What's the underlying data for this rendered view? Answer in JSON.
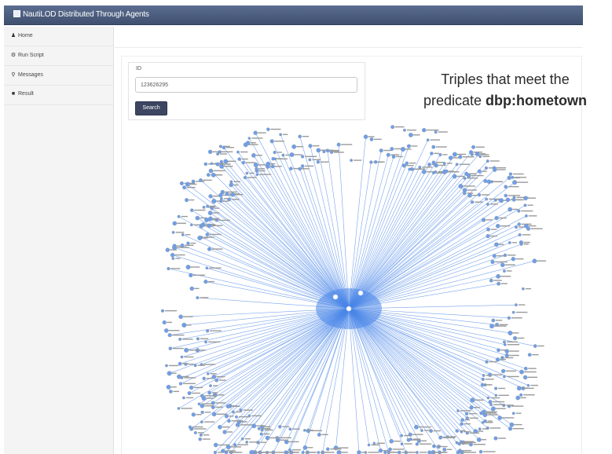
{
  "app": {
    "title": "NautiLOD Distributed Through Agents"
  },
  "sidebar": {
    "items": [
      {
        "label": "Home",
        "icon": "user-icon"
      },
      {
        "label": "Run Script",
        "icon": "gear-icon"
      },
      {
        "label": "Messages",
        "icon": "map-marker-icon"
      },
      {
        "label": "Result",
        "icon": "book-icon"
      }
    ]
  },
  "search": {
    "label": "ID",
    "value": "123626295",
    "button_label": "Search"
  },
  "caption": {
    "line1": "Triples that meet the",
    "line2_prefix": "predicate ",
    "predicate": "dbp:hometown"
  },
  "colors": {
    "navbar": "#4a5a7a",
    "graph_edge": "#4a86e8",
    "graph_node": "#6f9fe8"
  }
}
